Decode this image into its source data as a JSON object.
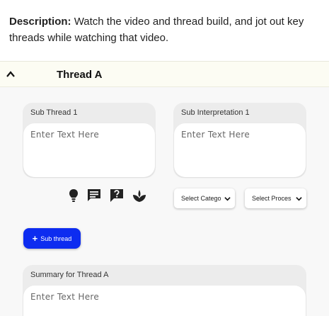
{
  "description": {
    "label": "Description:",
    "text": "Watch the video and thread build, and jot out key threads while watching that video."
  },
  "thread": {
    "title": "Thread A",
    "sub_thread": {
      "label": "Sub Thread 1",
      "placeholder": "Enter Text Here"
    },
    "sub_interpretation": {
      "label": "Sub Interpretation 1",
      "placeholder": "Enter Text Here"
    },
    "icons": [
      "lightbulb-icon",
      "comment-icon",
      "question-icon",
      "sprout-icon"
    ],
    "category_select": {
      "value": "Select Catego"
    },
    "process_select": {
      "value": "Select Proces"
    },
    "add_sub_thread": {
      "label": "Sub thread"
    },
    "summary": {
      "label": "Summary for Thread A",
      "placeholder": "Enter Text Here"
    }
  },
  "colors": {
    "accent": "#0d2cf0",
    "header_bg": "#fcfcf3",
    "card_bg": "#ececec"
  }
}
